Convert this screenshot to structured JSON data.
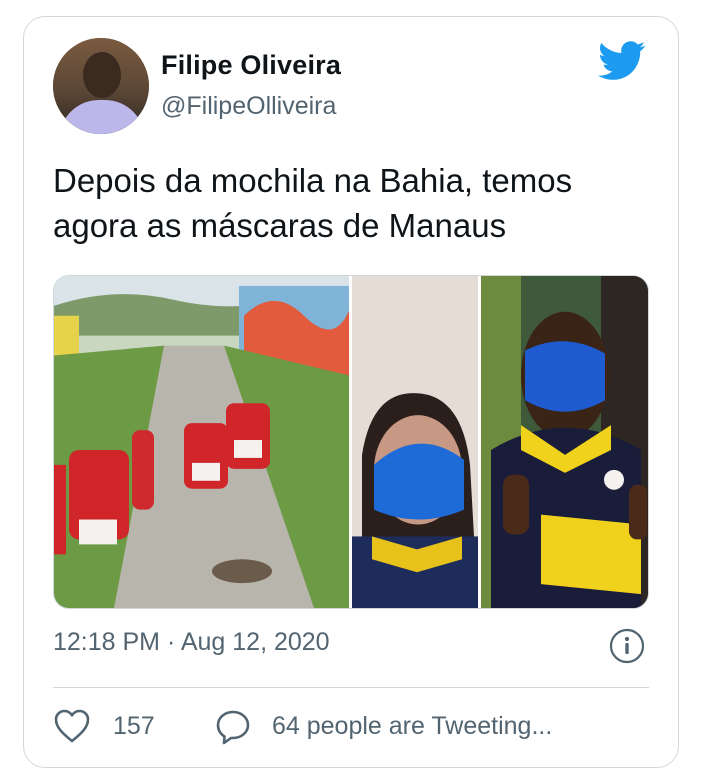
{
  "tweet": {
    "author": {
      "name": "Filipe Oliveira",
      "handle": "@FilipeOlliveira"
    },
    "text": "Depois da mochila na Bahia, temos agora as máscaras de Manaus",
    "timestamp": "12:18 PM · Aug 12, 2020",
    "likes": "157",
    "conversation": "64 people are Tweeting..."
  },
  "icons": {
    "platform": "twitter-bird-icon",
    "info": "info-icon",
    "like": "heart-icon",
    "reply": "reply-bubble-icon"
  },
  "colors": {
    "brand": "#1d9bf0",
    "muted": "#536471",
    "border": "#cfd9de"
  }
}
